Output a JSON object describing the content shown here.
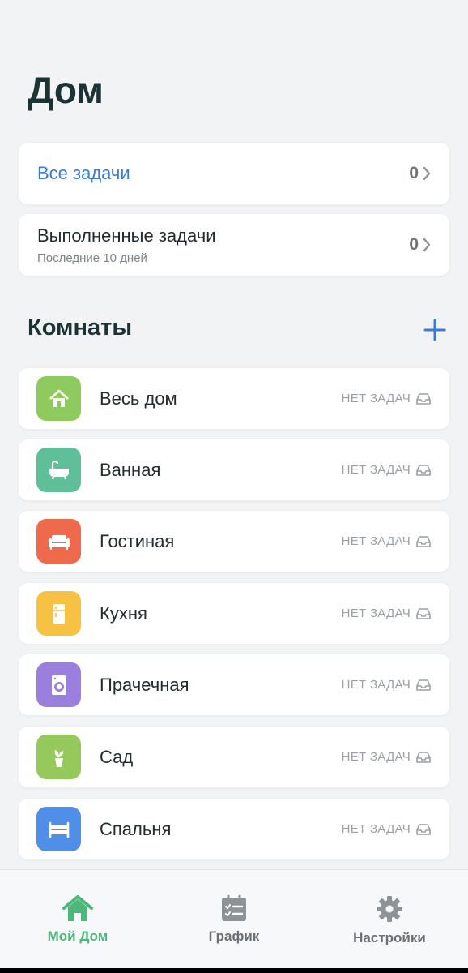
{
  "page": {
    "title": "Дом"
  },
  "summary": {
    "all_tasks": {
      "label": "Все задачи",
      "count": "0"
    },
    "done_tasks": {
      "label": "Выполненные задачи",
      "sublabel": "Последние 10 дней",
      "count": "0"
    }
  },
  "rooms": {
    "title": "Комнаты",
    "items": [
      {
        "name": "Весь дом",
        "status": "НЕТ ЗАДАЧ",
        "icon": "house-icon",
        "color": "#8fca5e"
      },
      {
        "name": "Ванная",
        "status": "НЕТ ЗАДАЧ",
        "icon": "bathtub-icon",
        "color": "#5fbf98"
      },
      {
        "name": "Гостиная",
        "status": "НЕТ ЗАДАЧ",
        "icon": "sofa-icon",
        "color": "#ef6a4d"
      },
      {
        "name": "Кухня",
        "status": "НЕТ ЗАДАЧ",
        "icon": "fridge-icon",
        "color": "#f7c244"
      },
      {
        "name": "Прачечная",
        "status": "НЕТ ЗАДАЧ",
        "icon": "washing-machine-icon",
        "color": "#9b7fdf"
      },
      {
        "name": "Сад",
        "status": "НЕТ ЗАДАЧ",
        "icon": "plant-icon",
        "color": "#96c95c"
      },
      {
        "name": "Спальня",
        "status": "НЕТ ЗАДАЧ",
        "icon": "bed-icon",
        "color": "#4f8fe8"
      }
    ]
  },
  "nav": {
    "home": {
      "label": "Мой Дом",
      "icon": "house-icon"
    },
    "schedule": {
      "label": "График",
      "icon": "checklist-icon"
    },
    "settings": {
      "label": "Настройки",
      "icon": "gear-icon"
    }
  },
  "colors": {
    "accent_blue": "#3a7bd5",
    "accent_green": "#4bb87a",
    "title": "#1c3234"
  }
}
